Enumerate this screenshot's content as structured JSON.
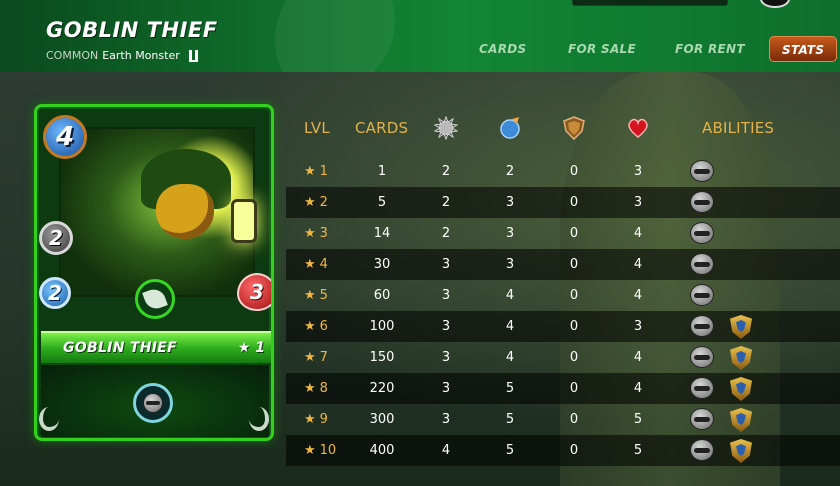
{
  "header": {
    "title": "GOBLIN THIEF",
    "rarity": "COMMON",
    "type": "Earth Monster",
    "edition_icon": "edition-u-icon"
  },
  "nav": [
    {
      "label": "CARDS",
      "active": false
    },
    {
      "label": "FOR SALE",
      "active": false
    },
    {
      "label": "FOR RENT",
      "active": false
    },
    {
      "label": "STATS",
      "active": true
    }
  ],
  "card": {
    "name": "GOBLIN THIEF",
    "level": "★ 1",
    "mana": "4",
    "attack": "2",
    "speed": "2",
    "health": "3",
    "element_icon": "earth-leaf-icon",
    "ability_icon": "stealth-ability-icon"
  },
  "table": {
    "headers": {
      "lvl": "LVL",
      "cards": "CARDS",
      "attack_icon": "melee-attack-icon",
      "speed_icon": "speed-icon",
      "armor_icon": "armor-shield-icon",
      "health_icon": "health-heart-icon",
      "abilities": "ABILITIES"
    },
    "rows": [
      {
        "star": "★",
        "lvl": "1",
        "cards": "1",
        "attack": "2",
        "speed": "2",
        "armor": "0",
        "health": "3",
        "abilities": [
          "stealth-ability-icon"
        ]
      },
      {
        "star": "★",
        "lvl": "2",
        "cards": "5",
        "attack": "2",
        "speed": "3",
        "armor": "0",
        "health": "3",
        "abilities": [
          "stealth-ability-icon"
        ]
      },
      {
        "star": "★",
        "lvl": "3",
        "cards": "14",
        "attack": "2",
        "speed": "3",
        "armor": "0",
        "health": "4",
        "abilities": [
          "stealth-ability-icon"
        ]
      },
      {
        "star": "★",
        "lvl": "4",
        "cards": "30",
        "attack": "3",
        "speed": "3",
        "armor": "0",
        "health": "4",
        "abilities": [
          "stealth-ability-icon"
        ]
      },
      {
        "star": "★",
        "lvl": "5",
        "cards": "60",
        "attack": "3",
        "speed": "4",
        "armor": "0",
        "health": "4",
        "abilities": [
          "stealth-ability-icon"
        ]
      },
      {
        "star": "★",
        "lvl": "6",
        "cards": "100",
        "attack": "3",
        "speed": "4",
        "armor": "0",
        "health": "3",
        "abilities": [
          "stealth-ability-icon",
          "divine-shield-icon"
        ]
      },
      {
        "star": "★",
        "lvl": "7",
        "cards": "150",
        "attack": "3",
        "speed": "4",
        "armor": "0",
        "health": "4",
        "abilities": [
          "stealth-ability-icon",
          "divine-shield-icon"
        ]
      },
      {
        "star": "★",
        "lvl": "8",
        "cards": "220",
        "attack": "3",
        "speed": "5",
        "armor": "0",
        "health": "4",
        "abilities": [
          "stealth-ability-icon",
          "divine-shield-icon"
        ]
      },
      {
        "star": "★",
        "lvl": "9",
        "cards": "300",
        "attack": "3",
        "speed": "5",
        "armor": "0",
        "health": "5",
        "abilities": [
          "stealth-ability-icon",
          "divine-shield-icon"
        ]
      },
      {
        "star": "★",
        "lvl": "10",
        "cards": "400",
        "attack": "4",
        "speed": "5",
        "armor": "0",
        "health": "5",
        "abilities": [
          "stealth-ability-icon",
          "divine-shield-icon"
        ]
      }
    ]
  },
  "colors": {
    "header_green": "#138534",
    "header_accent": "#e3b24a",
    "stats_button": "#c75a1a",
    "card_border": "#32d21c"
  }
}
